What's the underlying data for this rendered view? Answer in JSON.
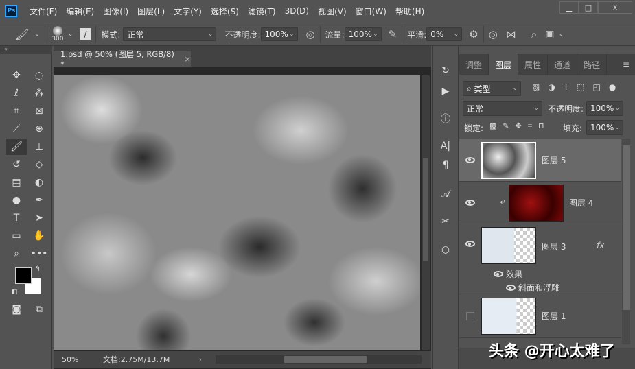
{
  "app": {
    "logo": "Ps"
  },
  "menu": [
    "文件(F)",
    "编辑(E)",
    "图像(I)",
    "图层(L)",
    "文字(Y)",
    "选择(S)",
    "滤镜(T)",
    "3D(D)",
    "视图(V)",
    "窗口(W)",
    "帮助(H)"
  ],
  "window_controls": {
    "minimize": "▁",
    "maximize": "□",
    "close": "X"
  },
  "options": {
    "brush_size": "300",
    "mode_label": "模式:",
    "mode_value": "正常",
    "opacity_label": "不透明度:",
    "opacity_value": "100%",
    "flow_label": "流量:",
    "flow_value": "100%",
    "smooth_label": "平滑:",
    "smooth_value": "0%"
  },
  "document": {
    "tab_title": "1.psd @ 50% (图层 5, RGB/8) *",
    "close": "×",
    "zoom": "50%",
    "doc_info": "文档:2.75M/13.7M"
  },
  "panel": {
    "tabs": [
      "调整",
      "图层",
      "属性",
      "通道",
      "路径"
    ],
    "active_tab": "图层",
    "filter_value": "类型",
    "blend_mode": "正常",
    "opacity_label": "不透明度:",
    "opacity_value": "100%",
    "lock_label": "锁定:",
    "fill_label": "填充:",
    "fill_value": "100%"
  },
  "layers": [
    {
      "name": "图层 5",
      "visible": true,
      "selected": true
    },
    {
      "name": "图层 4",
      "visible": true
    },
    {
      "name": "图层 3",
      "visible": true,
      "fx": "fx",
      "effects_label": "效果",
      "effect": "斜面和浮雕"
    },
    {
      "name": "图层 1",
      "visible": false
    }
  ],
  "watermark": "头条 @开心太难了"
}
